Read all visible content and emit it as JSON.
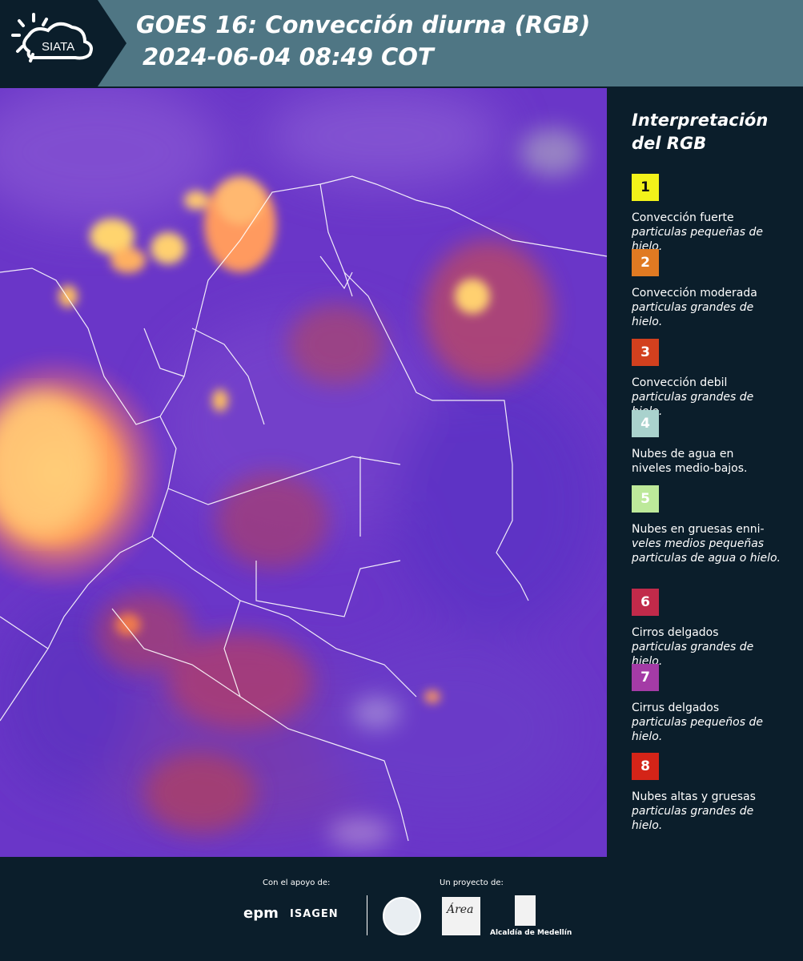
{
  "header": {
    "logo_text": "SIATA",
    "title_line1": "GOES 16: Convección diurna (RGB)",
    "title_line2": "2024-06-04 08:49 COT"
  },
  "legend": {
    "title_line1": "Interpretación",
    "title_line2": "del RGB",
    "items": [
      {
        "num": "1",
        "color": "#f2f21a",
        "label": "Convección fuerte",
        "desc": "particulas pequeñas de hielo."
      },
      {
        "num": "2",
        "color": "#e07a22",
        "label": "Convección moderada",
        "desc": "particulas grandes de hielo."
      },
      {
        "num": "3",
        "color": "#d2401e",
        "label": "Convección debil",
        "desc": "particulas grandes de hielo."
      },
      {
        "num": "4",
        "color": "#a9d2cd",
        "label": "Nubes de agua en",
        "desc": "niveles medio-bajos."
      },
      {
        "num": "5",
        "color": "#bde99a",
        "label": "Nubes en gruesas enni-",
        "desc": "veles medios pequeñas particulas de agua o hielo."
      },
      {
        "num": "6",
        "color": "#c12a4a",
        "label": "Cirros delgados",
        "desc": "particulas grandes de hielo."
      },
      {
        "num": "7",
        "color": "#a43ba6",
        "label": "Cirrus delgados",
        "desc": "particulas pequeños de hielo."
      },
      {
        "num": "8",
        "color": "#d42418",
        "label": "Nubes altas y gruesas",
        "desc": "particulas grandes de hielo."
      }
    ]
  },
  "footer": {
    "support_label": "Con el apoyo de:",
    "project_label": "Un proyecto de:",
    "sponsor_epm": "epm",
    "sponsor_isagen": "ISAGEN",
    "area_text": "Área",
    "medellin_text": "Alcaldía de Medellín"
  }
}
